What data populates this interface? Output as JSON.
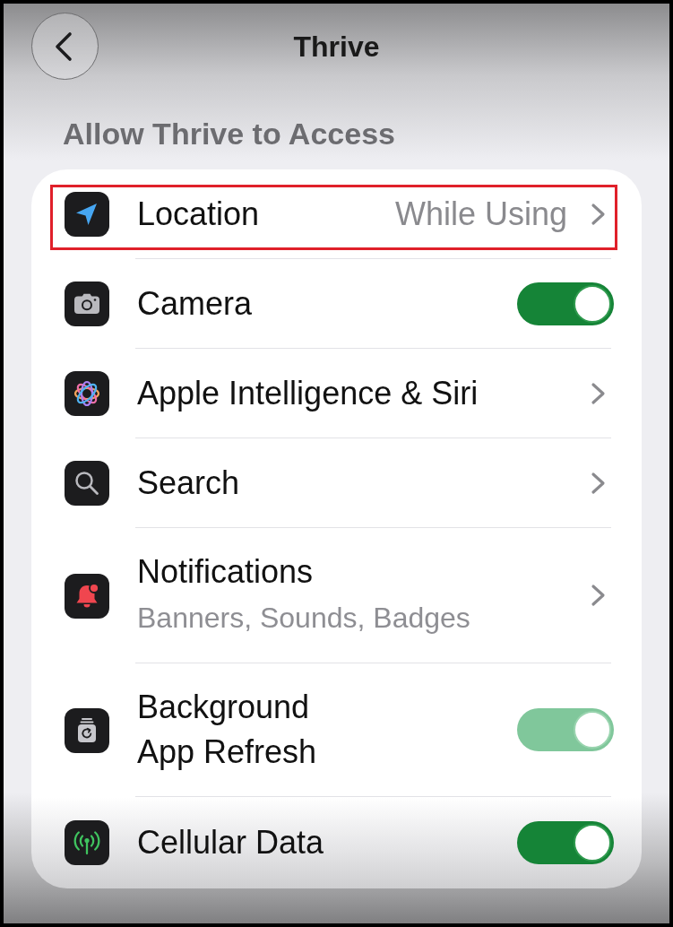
{
  "header": {
    "title": "Thrive"
  },
  "section": {
    "heading": "Allow Thrive to Access",
    "rows": [
      {
        "kind": "link",
        "label": "Location",
        "value": "While Using",
        "highlighted": true
      },
      {
        "kind": "toggle",
        "label": "Camera",
        "on": true,
        "disabled": false,
        "highlighted": false
      },
      {
        "kind": "link",
        "label": "Apple Intelligence & Siri",
        "highlighted": false
      },
      {
        "kind": "link",
        "label": "Search",
        "highlighted": false
      },
      {
        "kind": "link",
        "label": "Notifications",
        "subtitle": "Banners, Sounds, Badges",
        "highlighted": false
      },
      {
        "kind": "toggle",
        "label": "Background App Refresh",
        "on": true,
        "disabled": true,
        "highlighted": false
      },
      {
        "kind": "toggle",
        "label": "Cellular Data",
        "on": true,
        "disabled": false,
        "highlighted": false
      }
    ]
  }
}
